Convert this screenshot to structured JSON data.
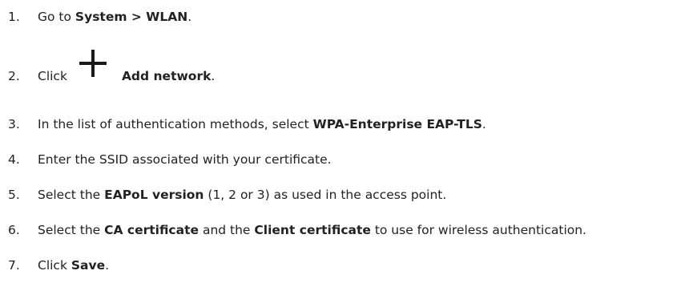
{
  "steps": [
    {
      "num": "1.",
      "parts": [
        "Go to ",
        "System > WLAN",
        "."
      ]
    },
    {
      "num": "2.",
      "parts": [
        "Click",
        "Add network",
        "."
      ],
      "icon": "plus-icon"
    },
    {
      "num": "3.",
      "parts": [
        "In the list of authentication methods, select ",
        "WPA-Enterprise EAP-TLS",
        "."
      ]
    },
    {
      "num": "4.",
      "parts": [
        "Enter the SSID associated with your certificate."
      ]
    },
    {
      "num": "5.",
      "parts": [
        "Select the ",
        "EAPoL version",
        " (1, 2 or 3) as used in the access point."
      ]
    },
    {
      "num": "6.",
      "parts": [
        "Select the ",
        "CA certificate",
        " and the ",
        "Client certificate",
        " to use for wireless authentication."
      ]
    },
    {
      "num": "7.",
      "parts": [
        "Click ",
        "Save",
        "."
      ]
    }
  ]
}
